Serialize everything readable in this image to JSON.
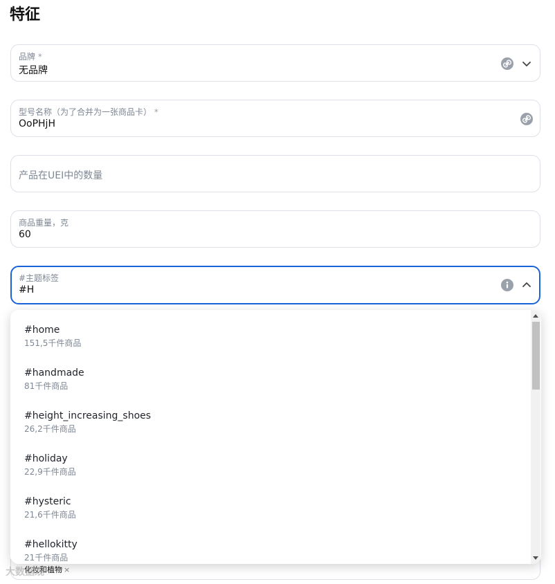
{
  "section_title": "特征",
  "fields": {
    "brand": {
      "label": "品牌",
      "required_mark": "*",
      "value": "无品牌"
    },
    "model_name": {
      "label": "型号名称（为了合并为一张商品卡）",
      "required_mark": "*",
      "value": "OoPHjH"
    },
    "uei_qty": {
      "placeholder": "产品在UEI中的数量"
    },
    "weight": {
      "label": "商品重量，克",
      "value": "60"
    },
    "hashtags": {
      "label": "#主题标签",
      "value": "#H"
    }
  },
  "suggestions": [
    {
      "tag": "#home",
      "count": "151,5千件商品"
    },
    {
      "tag": "#handmade",
      "count": "81千件商品"
    },
    {
      "tag": "#height_increasing_shoes",
      "count": "26,2千件商品"
    },
    {
      "tag": "#holiday",
      "count": "22,9千件商品"
    },
    {
      "tag": "#hysteric",
      "count": "21,6千件商品"
    },
    {
      "tag": "#hellokitty",
      "count": "21千件商品"
    }
  ],
  "under_chip": {
    "label": "化妆和植物",
    "remove": "×"
  },
  "watermark": "大数据观",
  "colors": {
    "accent": "#1a63d9",
    "icon_gray": "#9aa1ab",
    "muted_text": "#7e8794"
  },
  "icons": [
    "link-icon",
    "chevron-down-icon",
    "info-icon",
    "chevron-up-icon"
  ]
}
